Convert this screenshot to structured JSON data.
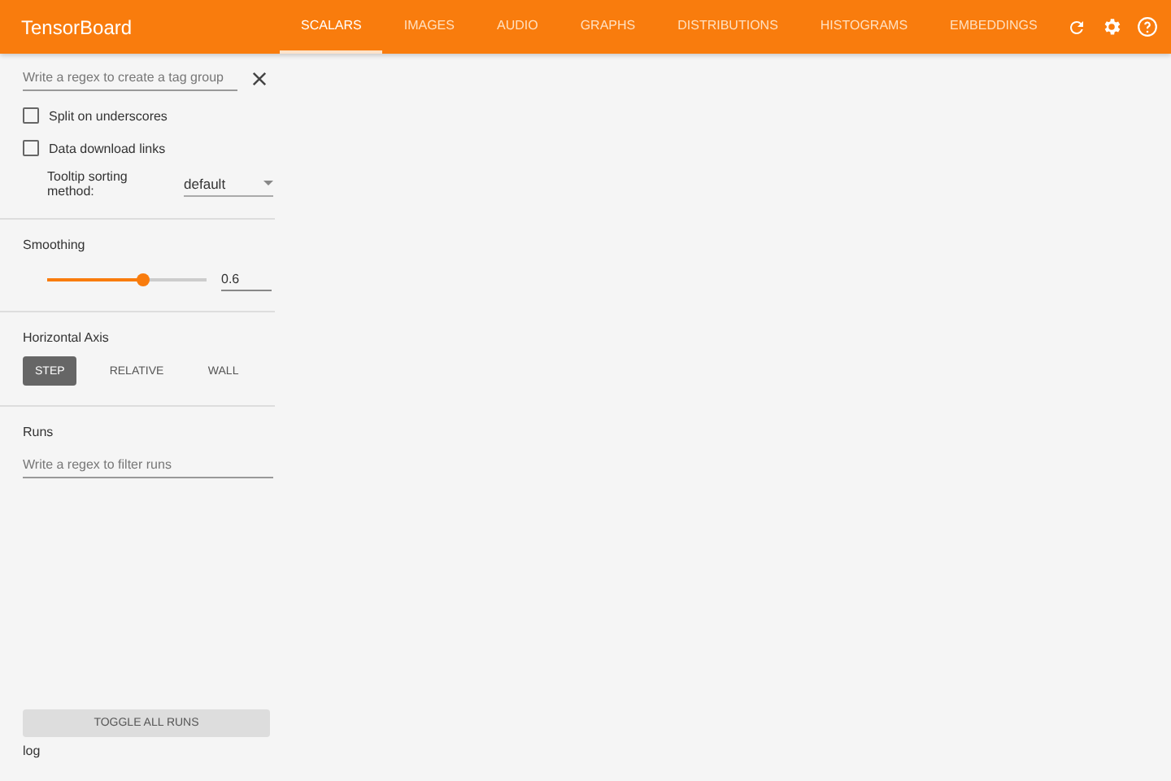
{
  "header": {
    "title": "TensorBoard",
    "tabs": [
      {
        "label": "SCALARS",
        "selected": true
      },
      {
        "label": "IMAGES",
        "selected": false
      },
      {
        "label": "AUDIO",
        "selected": false
      },
      {
        "label": "GRAPHS",
        "selected": false
      },
      {
        "label": "DISTRIBUTIONS",
        "selected": false
      },
      {
        "label": "HISTOGRAMS",
        "selected": false
      },
      {
        "label": "EMBEDDINGS",
        "selected": false
      }
    ]
  },
  "sidebar": {
    "tag_filter": {
      "placeholder": "Write a regex to create a tag group"
    },
    "options": [
      {
        "label": "Split on underscores",
        "checked": false
      },
      {
        "label": "Data download links",
        "checked": false
      }
    ],
    "tooltip_sorting": {
      "label": "Tooltip sorting method:",
      "value": "default"
    },
    "smoothing": {
      "label": "Smoothing",
      "level": 0.6,
      "value": "0.6"
    },
    "horizontal_axis": {
      "label": "Horizontal Axis",
      "options": [
        {
          "label": "STEP",
          "selected": true
        },
        {
          "label": "RELATIVE",
          "selected": false
        },
        {
          "label": "WALL",
          "selected": false
        }
      ]
    },
    "runs": {
      "label": "Runs",
      "placeholder": "Write a regex to filter runs",
      "toggle_button": "TOGGLE ALL RUNS",
      "items": [
        "log"
      ]
    }
  }
}
